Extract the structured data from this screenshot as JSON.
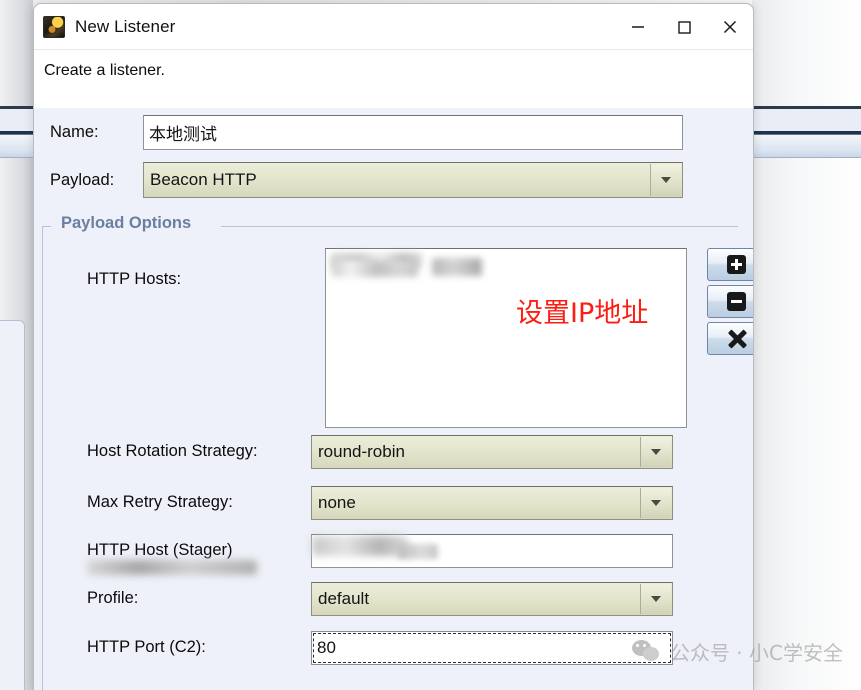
{
  "window": {
    "title": "New Listener",
    "icon": "app-icon",
    "minimize_label": "Minimize",
    "maximize_label": "Maximize",
    "close_label": "Close"
  },
  "description": "Create a listener.",
  "form": {
    "name_label": "Name:",
    "name_value": "本地测试",
    "payload_label": "Payload:",
    "payload_value": "Beacon HTTP"
  },
  "payload_options": {
    "group_title": "Payload Options",
    "http_hosts_label": "HTTP Hosts:",
    "http_hosts_value": "",
    "annotation": "设置IP地址",
    "add_button_label": "+",
    "remove_button_label": "-",
    "clear_button_label": "X",
    "host_rotation_label": "Host Rotation Strategy:",
    "host_rotation_value": "round-robin",
    "max_retry_label": "Max Retry Strategy:",
    "max_retry_value": "none",
    "http_host_stager_label": "HTTP Host (Stager)",
    "http_host_stager_value": "",
    "profile_label": "Profile:",
    "profile_value": "default",
    "http_port_label": "HTTP Port (C2):",
    "http_port_value": "80"
  },
  "watermark": {
    "text": "公众号 · 小C学安全"
  },
  "colors": {
    "dialog_bg": "#eef1f9",
    "combo_bg": "#e4e5cd",
    "group_title": "#6b7fa0",
    "annotation_red": "#fd1d12"
  }
}
